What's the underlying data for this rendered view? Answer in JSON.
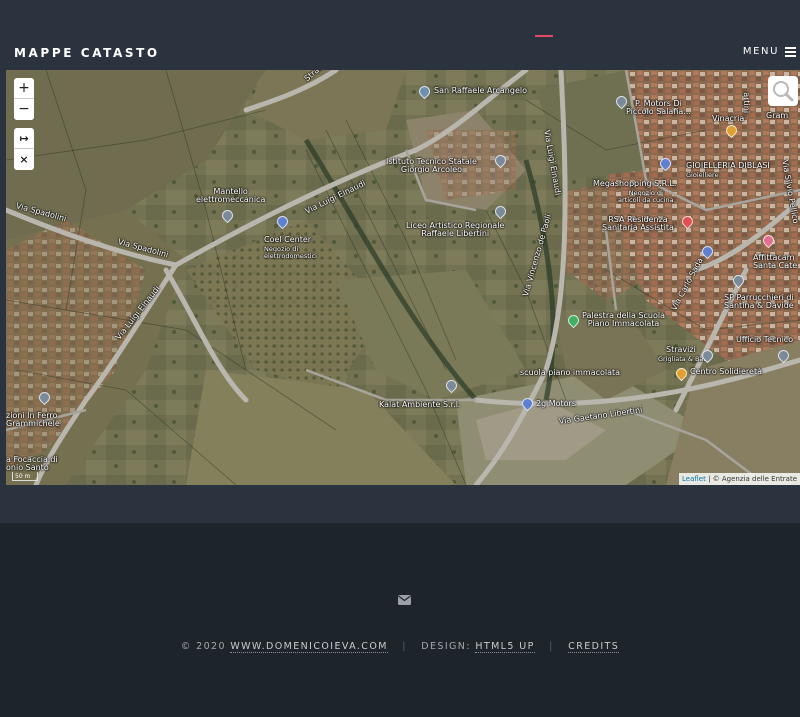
{
  "header": {
    "site_title": "MAPPE CATASTO",
    "menu_label": "MENU"
  },
  "map": {
    "controls": {
      "zoom_in": "+",
      "zoom_out": "−",
      "measure": "↦",
      "clear": "×"
    },
    "labels": {
      "san_raffaele": "San Raffaele Arcangelo",
      "strada": "Strada S",
      "via_luigi_einaudi_top": "Via Luigi Einaudi",
      "via_luigi_einaudi_mid": "Via Luigi Einaudi",
      "via_luigi_einaudi_low": "Via Luigi Einaudi",
      "via_spadolini_1": "Via Spadolini",
      "via_spadolini_2": "Via Spadolini",
      "istituto": "Istituto Tecnico Statale\nGiorgio Arcoleo",
      "mantello": "Mantello\nelettromeccanica",
      "coel": "Coel Center",
      "coel_sub": "Negozio di\nelettrodomestici",
      "liceo": "Liceo Artistico Regionale\nRaffaele Libertini",
      "via_vincenzo": "Via Vincenzo de Paoli",
      "p_motors": "P. Motors Di\nPiccolo Salafia...",
      "vinacria": "Vinacria",
      "gioielleria": "GIOIELLERIA DIBLASI",
      "gioielleria_sub": "Gioielliere",
      "megashopping": "Megashopping S.R.L.",
      "megashopping_sub": "Negozio di\narticoli da cucina",
      "rsa": "RSA Residenza\nSanitaria Assistita",
      "affittacam": "Affittacam\nSanta Cate",
      "via_silvio": "Via Silvio Pellico",
      "grann": "Gram",
      "artini": "artini",
      "palestra": "Palestra della Scuola\nPiano Immacolata",
      "via_carlo": "Via Carlo Sada",
      "sp_parrucchieri": "SP Parrucchieri di\nSantina & Davide",
      "ufficio": "Ufficio Tecnico",
      "stravizi": "Stravizi",
      "stravizi_sub": "Grigliata & Bar",
      "centro": "Centro Solidieretà",
      "scuola": "scuola piano immacolata",
      "kalat": "Kalat Ambiente S.r.l.",
      "motors_2g": "2g Motors",
      "via_gaetano": "Via Gaetano Libertini",
      "zioni_ferro": "zioni In Ferro\nGrammichele",
      "focaccia": "a Focaccia di\nonio Santo"
    },
    "scale": "50 m",
    "attribution_link": "Leaflet",
    "attribution_text": " | © Agenzia delle Entrate"
  },
  "footer": {
    "copyright": "© 2020",
    "site_link": "WWW.DOMENICOIEVA.COM",
    "design_label": "DESIGN:",
    "design_link": "HTML5 UP",
    "credits_link": "CREDITS"
  },
  "colors": {
    "accent": "#e44c65",
    "header_bg": "#2b333e",
    "page_bg": "#1d242a"
  }
}
